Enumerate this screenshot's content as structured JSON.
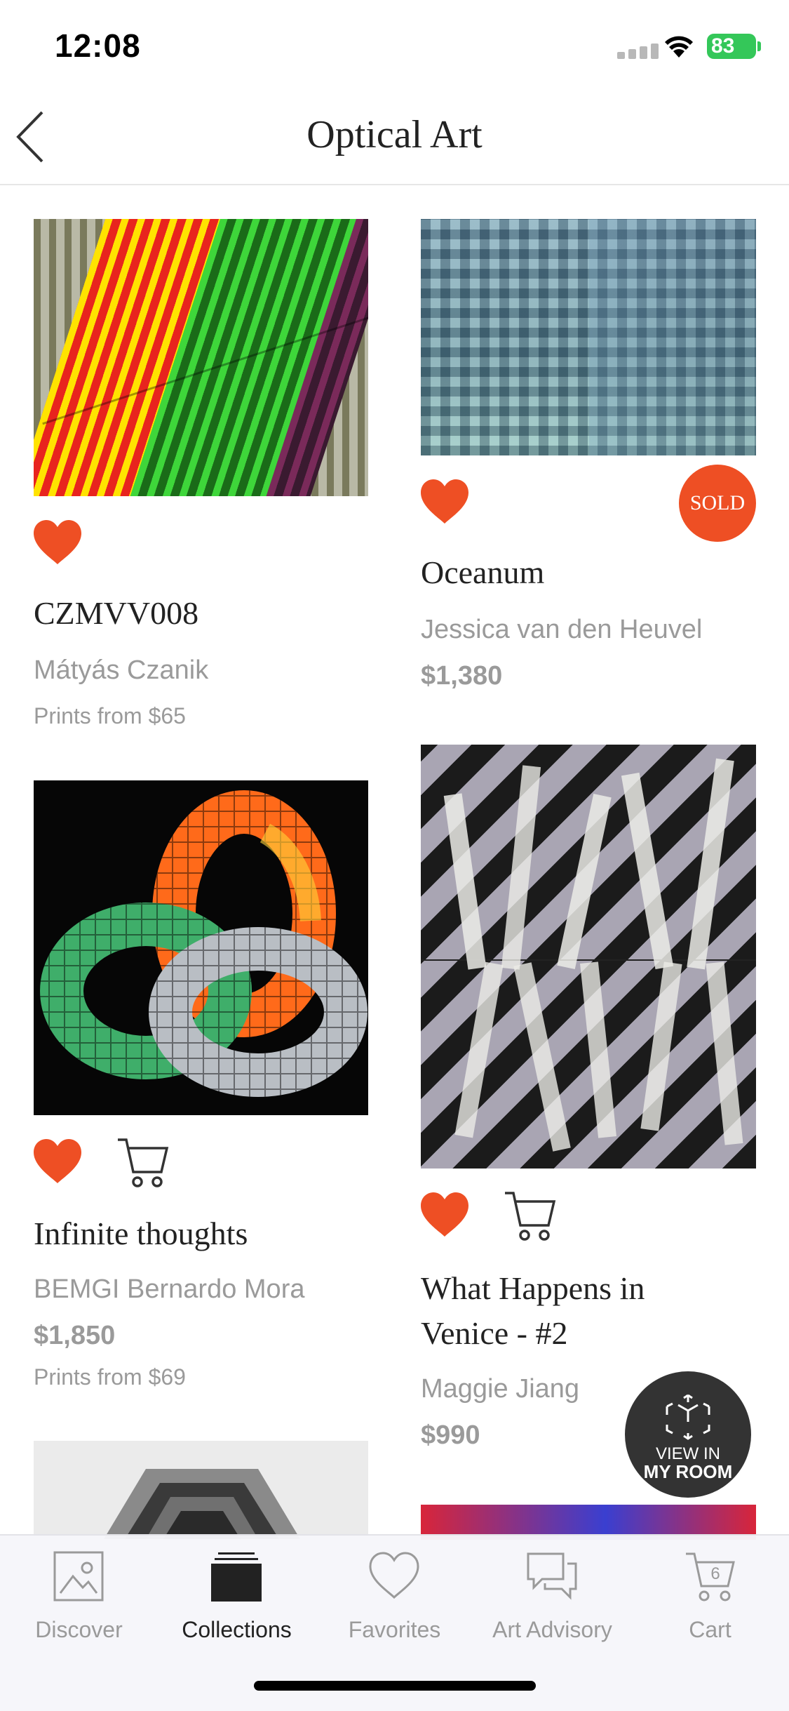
{
  "status_bar": {
    "time": "12:08",
    "battery": "83"
  },
  "nav": {
    "title": "Optical Art"
  },
  "artworks": [
    {
      "title": "CZMVV008",
      "artist": "Mátyás Czanik",
      "price": "",
      "prints": "Prints from $65",
      "favorited": true,
      "sold": false
    },
    {
      "title": "Oceanum",
      "artist": "Jessica van den Heuvel",
      "price": "$1,380",
      "prints": "",
      "favorited": true,
      "sold": true,
      "sold_label": "SOLD"
    },
    {
      "title": "Infinite thoughts",
      "artist": "BEMGI Bernardo Mora",
      "price": "$1,850",
      "prints": "Prints from $69",
      "favorited": true,
      "sold": false
    },
    {
      "title": "What Happens in Venice - #2",
      "artist": "Maggie Jiang",
      "price": "$990",
      "prints": "",
      "favorited": true,
      "sold": false
    }
  ],
  "view_in_room": {
    "line1": "VIEW IN",
    "line2": "MY ROOM"
  },
  "tabs": [
    {
      "label": "Discover",
      "icon": "image-icon",
      "active": false
    },
    {
      "label": "Collections",
      "icon": "collections-icon",
      "active": true
    },
    {
      "label": "Favorites",
      "icon": "heart-icon",
      "active": false
    },
    {
      "label": "Art Advisory",
      "icon": "chat-icon",
      "active": false
    },
    {
      "label": "Cart",
      "icon": "cart-icon",
      "active": false,
      "badge": "6"
    }
  ],
  "colors": {
    "accent": "#ee4f24",
    "active_tab": "#222222",
    "inactive": "#9a9a9a"
  }
}
